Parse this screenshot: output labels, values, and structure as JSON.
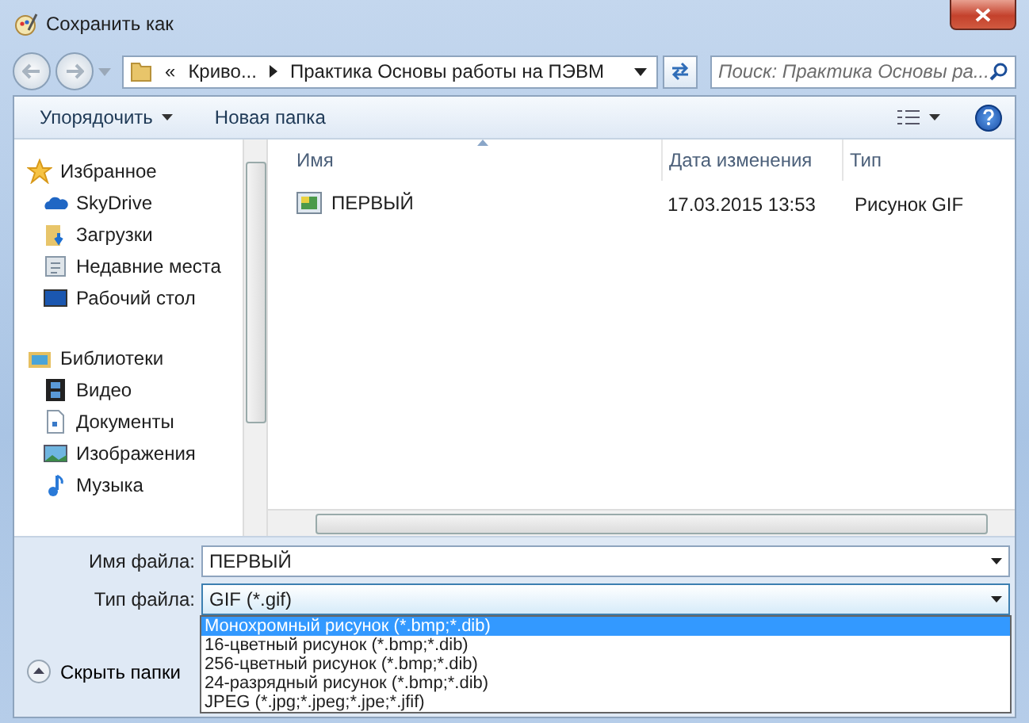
{
  "window": {
    "title": "Сохранить как"
  },
  "address_bar": {
    "overflow": "«",
    "crumbs": [
      "Криво...",
      "Практика Основы работы на ПЭВМ"
    ]
  },
  "search": {
    "placeholder": "Поиск: Практика Основы ра..."
  },
  "toolbar": {
    "organize": "Упорядочить",
    "new_folder": "Новая папка"
  },
  "sidebar": {
    "groups": [
      {
        "label": "Избранное",
        "kind": "star",
        "children": [
          {
            "label": "SkyDrive",
            "kind": "cloud"
          },
          {
            "label": "Загрузки",
            "kind": "download"
          },
          {
            "label": "Недавние места",
            "kind": "recent"
          },
          {
            "label": "Рабочий стол",
            "kind": "desktop"
          }
        ]
      },
      {
        "label": "Библиотеки",
        "kind": "library",
        "children": [
          {
            "label": "Видео",
            "kind": "video"
          },
          {
            "label": "Документы",
            "kind": "document"
          },
          {
            "label": "Изображения",
            "kind": "image"
          },
          {
            "label": "Музыка",
            "kind": "music"
          }
        ]
      }
    ]
  },
  "file_list": {
    "columns": [
      "Имя",
      "Дата изменения",
      "Тип"
    ],
    "rows": [
      {
        "name": "ПЕРВЫЙ",
        "date": "17.03.2015 13:53",
        "type": "Рисунок GIF"
      }
    ]
  },
  "form": {
    "file_name": {
      "label": "Имя файла:",
      "value": "ПЕРВЫЙ"
    },
    "file_type": {
      "label": "Тип файла:",
      "value": "GIF (*.gif)",
      "expanded": true,
      "options": [
        {
          "label": "Монохромный рисунок (*.bmp;*.dib)",
          "selected": true
        },
        {
          "label": "16-цветный рисунок (*.bmp;*.dib)",
          "selected": false
        },
        {
          "label": "256-цветный рисунок (*.bmp;*.dib)",
          "selected": false
        },
        {
          "label": "24-разрядный рисунок (*.bmp;*.dib)",
          "selected": false
        },
        {
          "label": "JPEG (*.jpg;*.jpeg;*.jpe;*.jfif)",
          "selected": false
        }
      ]
    }
  },
  "hide_folders": "Скрыть папки"
}
